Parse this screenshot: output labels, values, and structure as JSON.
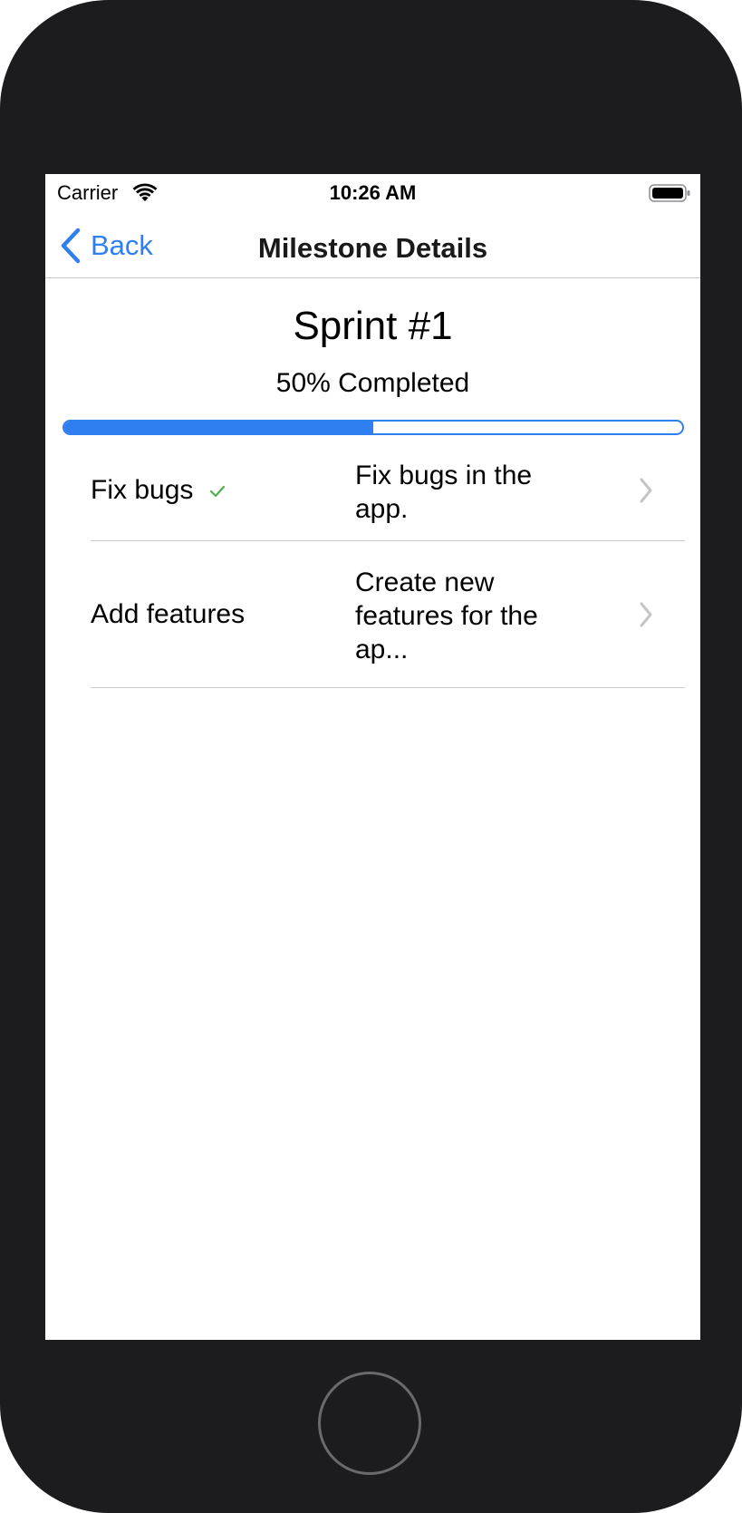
{
  "status_bar": {
    "carrier": "Carrier",
    "time": "10:26 AM",
    "icons": [
      "wifi-icon",
      "battery-icon"
    ]
  },
  "nav": {
    "back_label": "Back",
    "title": "Milestone Details",
    "back_icon": "chevron-left-icon"
  },
  "milestone": {
    "title": "Sprint #1",
    "progress_label": "50% Completed",
    "progress_percent": 50
  },
  "tasks": [
    {
      "name": "Fix bugs",
      "completed": true,
      "description": "Fix bugs in the app."
    },
    {
      "name": "Add features",
      "completed": false,
      "description": "Create new features for the ap..."
    }
  ],
  "colors": {
    "accent": "#2f7ff0",
    "check": "#4caf50",
    "chevron": "#c4c4c7",
    "device": "#1c1c1e"
  }
}
